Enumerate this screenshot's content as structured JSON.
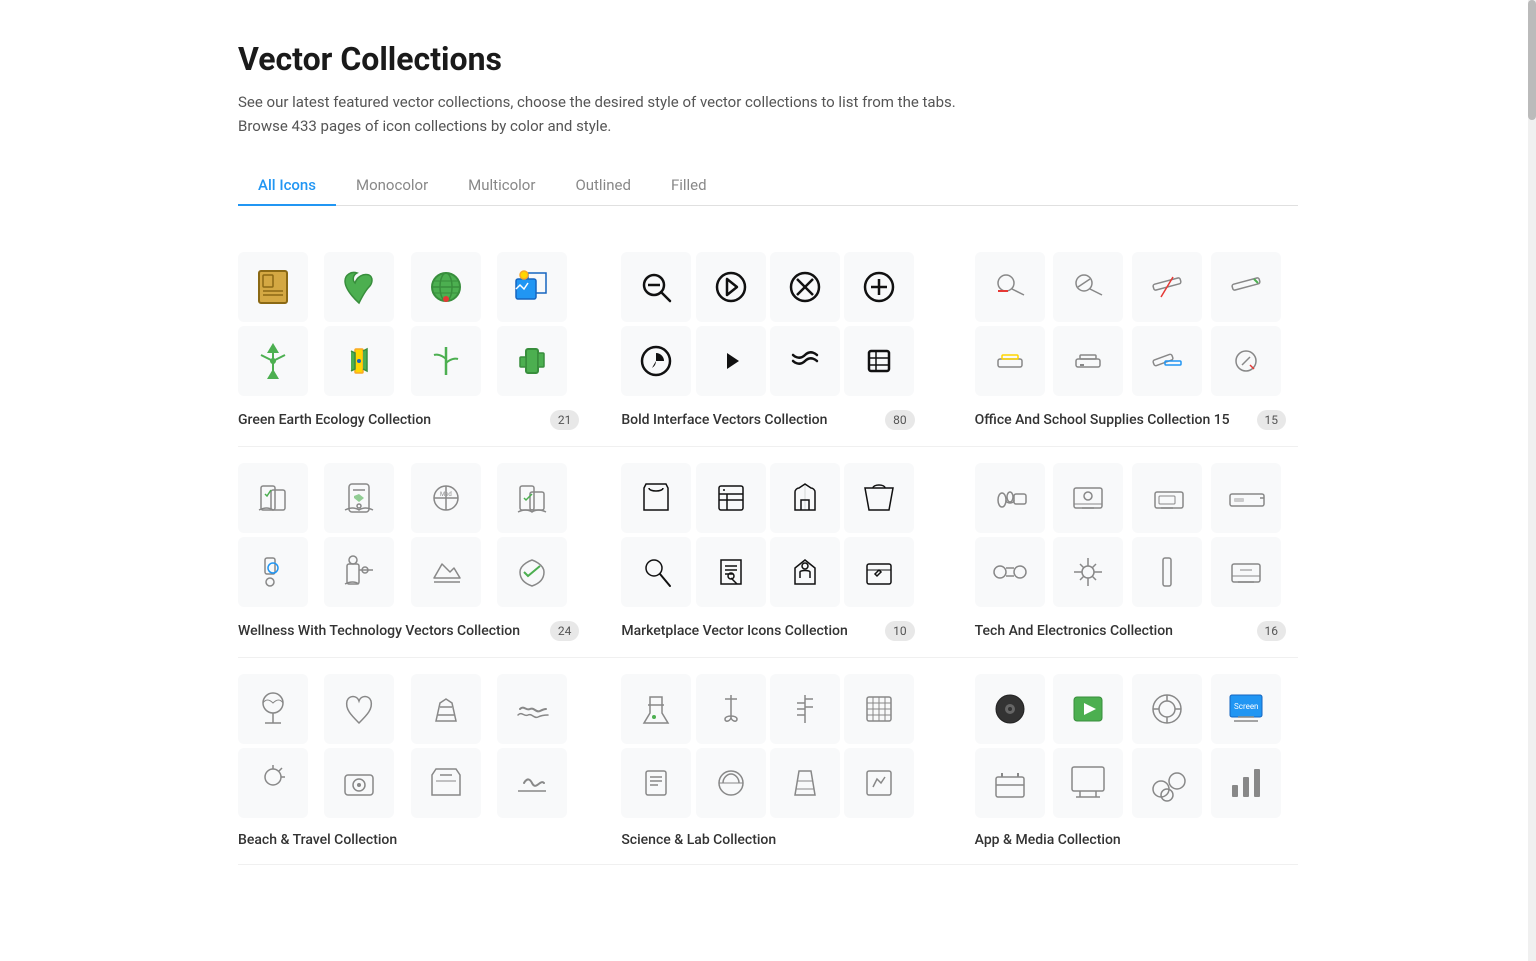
{
  "page": {
    "title": "Vector Collections",
    "subtitle_line1": "See our latest featured vector collections, choose the desired style of vector collections to list from the tabs.",
    "subtitle_line2": "Browse 433 pages of icon collections by color and style."
  },
  "tabs": [
    {
      "label": "All Icons",
      "active": true
    },
    {
      "label": "Monocolor",
      "active": false
    },
    {
      "label": "Multicolor",
      "active": false
    },
    {
      "label": "Outlined",
      "active": false
    },
    {
      "label": "Filled",
      "active": false
    }
  ],
  "collections": [
    {
      "name": "Green Earth Ecology Collection",
      "count": "21"
    },
    {
      "name": "Bold Interface Vectors Collection",
      "count": "80"
    },
    {
      "name": "Office And School Supplies Collection 15",
      "count": "15"
    },
    {
      "name": "Wellness With Technology Vectors Collection",
      "count": "24"
    },
    {
      "name": "Marketplace Vector Icons Collection",
      "count": "10"
    },
    {
      "name": "Tech And Electronics Collection",
      "count": "16"
    }
  ]
}
